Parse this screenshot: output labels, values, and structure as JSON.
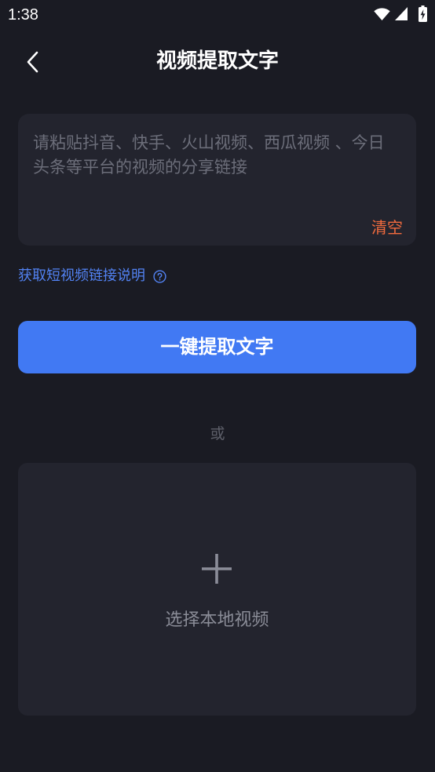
{
  "status_bar": {
    "time": "1:38",
    "icons": [
      "wifi-icon",
      "signal-icon",
      "battery-charging-icon"
    ]
  },
  "header": {
    "back_icon": "chevron-left-icon",
    "title": "视频提取文字"
  },
  "link_input": {
    "value": "",
    "placeholder": "请粘贴抖音、快手、火山视频、西瓜视频 、今日头条等平台的视频的分享链接",
    "clear_label": "清空"
  },
  "help_link": {
    "label": "获取短视频链接说明",
    "icon": "question-circle-icon"
  },
  "extract_button": {
    "label": "一键提取文字"
  },
  "divider": {
    "text": "或"
  },
  "local_upload": {
    "icon": "plus-icon",
    "label": "选择本地视频"
  },
  "colors": {
    "background": "#1a1b23",
    "card": "#23242e",
    "text": "#ffffff",
    "accent": "#4179f3",
    "link": "#5282f2",
    "clear": "#f26b3e",
    "muted": "#8a8c97",
    "placeholder": "#6c6e7a",
    "divider_text": "#5e606a"
  }
}
